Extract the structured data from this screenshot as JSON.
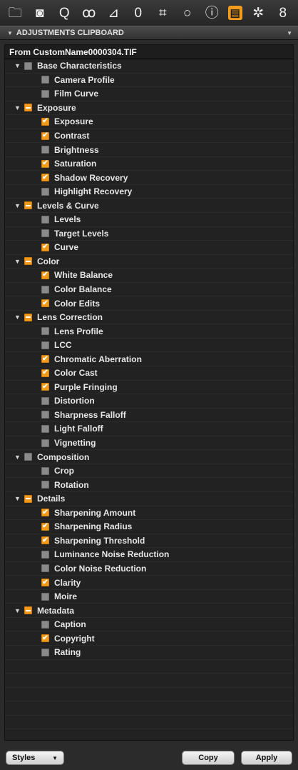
{
  "toolbar": {
    "icons": [
      {
        "name": "folder-icon",
        "glyph": "🗀"
      },
      {
        "name": "camera-icon",
        "glyph": "◙"
      },
      {
        "name": "search-q-icon",
        "glyph": "Q"
      },
      {
        "name": "color-circles-icon",
        "glyph": "ꝏ"
      },
      {
        "name": "exposure-triangle-icon",
        "glyph": "⊿"
      },
      {
        "name": "lens-icon",
        "glyph": "0"
      },
      {
        "name": "crop-icon",
        "glyph": "⌗"
      },
      {
        "name": "comment-icon",
        "glyph": "○"
      },
      {
        "name": "info-icon",
        "glyph": "ⓘ"
      },
      {
        "name": "adjustments-icon",
        "glyph": "▤",
        "active": true
      },
      {
        "name": "settings-icon",
        "glyph": "✲"
      },
      {
        "name": "batch-icon",
        "glyph": "8"
      }
    ],
    "accent": "#f39b1b"
  },
  "header": {
    "title": "ADJUSTMENTS CLIPBOARD"
  },
  "panel": {
    "source": "From CustomName0000304.TIF",
    "groups": [
      {
        "label": "Base Characteristics",
        "state": "unchecked",
        "items": [
          {
            "label": "Camera Profile",
            "checked": false
          },
          {
            "label": "Film Curve",
            "checked": false
          }
        ]
      },
      {
        "label": "Exposure",
        "state": "mixed",
        "items": [
          {
            "label": "Exposure",
            "checked": true
          },
          {
            "label": "Contrast",
            "checked": true
          },
          {
            "label": "Brightness",
            "checked": false
          },
          {
            "label": "Saturation",
            "checked": true
          },
          {
            "label": "Shadow Recovery",
            "checked": true
          },
          {
            "label": "Highlight Recovery",
            "checked": false
          }
        ]
      },
      {
        "label": "Levels & Curve",
        "state": "mixed",
        "items": [
          {
            "label": "Levels",
            "checked": false
          },
          {
            "label": "Target Levels",
            "checked": false
          },
          {
            "label": "Curve",
            "checked": true
          }
        ]
      },
      {
        "label": "Color",
        "state": "mixed",
        "items": [
          {
            "label": "White Balance",
            "checked": true
          },
          {
            "label": "Color Balance",
            "checked": false
          },
          {
            "label": "Color Edits",
            "checked": true
          }
        ]
      },
      {
        "label": "Lens Correction",
        "state": "mixed",
        "items": [
          {
            "label": "Lens Profile",
            "checked": false
          },
          {
            "label": "LCC",
            "checked": false
          },
          {
            "label": "Chromatic Aberration",
            "checked": true
          },
          {
            "label": "Color Cast",
            "checked": true
          },
          {
            "label": "Purple Fringing",
            "checked": true
          },
          {
            "label": "Distortion",
            "checked": false
          },
          {
            "label": "Sharpness Falloff",
            "checked": false
          },
          {
            "label": "Light Falloff",
            "checked": false
          },
          {
            "label": "Vignetting",
            "checked": false
          }
        ]
      },
      {
        "label": "Composition",
        "state": "unchecked",
        "items": [
          {
            "label": "Crop",
            "checked": false
          },
          {
            "label": "Rotation",
            "checked": false
          }
        ]
      },
      {
        "label": "Details",
        "state": "mixed",
        "items": [
          {
            "label": "Sharpening Amount",
            "checked": true
          },
          {
            "label": "Sharpening Radius",
            "checked": true
          },
          {
            "label": "Sharpening Threshold",
            "checked": true
          },
          {
            "label": "Luminance Noise Reduction",
            "checked": false
          },
          {
            "label": "Color Noise Reduction",
            "checked": false
          },
          {
            "label": "Clarity",
            "checked": true
          },
          {
            "label": "Moire",
            "checked": false
          }
        ]
      },
      {
        "label": "Metadata",
        "state": "mixed",
        "items": [
          {
            "label": "Caption",
            "checked": false
          },
          {
            "label": "Copyright",
            "checked": true
          },
          {
            "label": "Rating",
            "checked": false
          }
        ]
      }
    ]
  },
  "footer": {
    "styles_label": "Styles",
    "copy_label": "Copy",
    "apply_label": "Apply"
  }
}
